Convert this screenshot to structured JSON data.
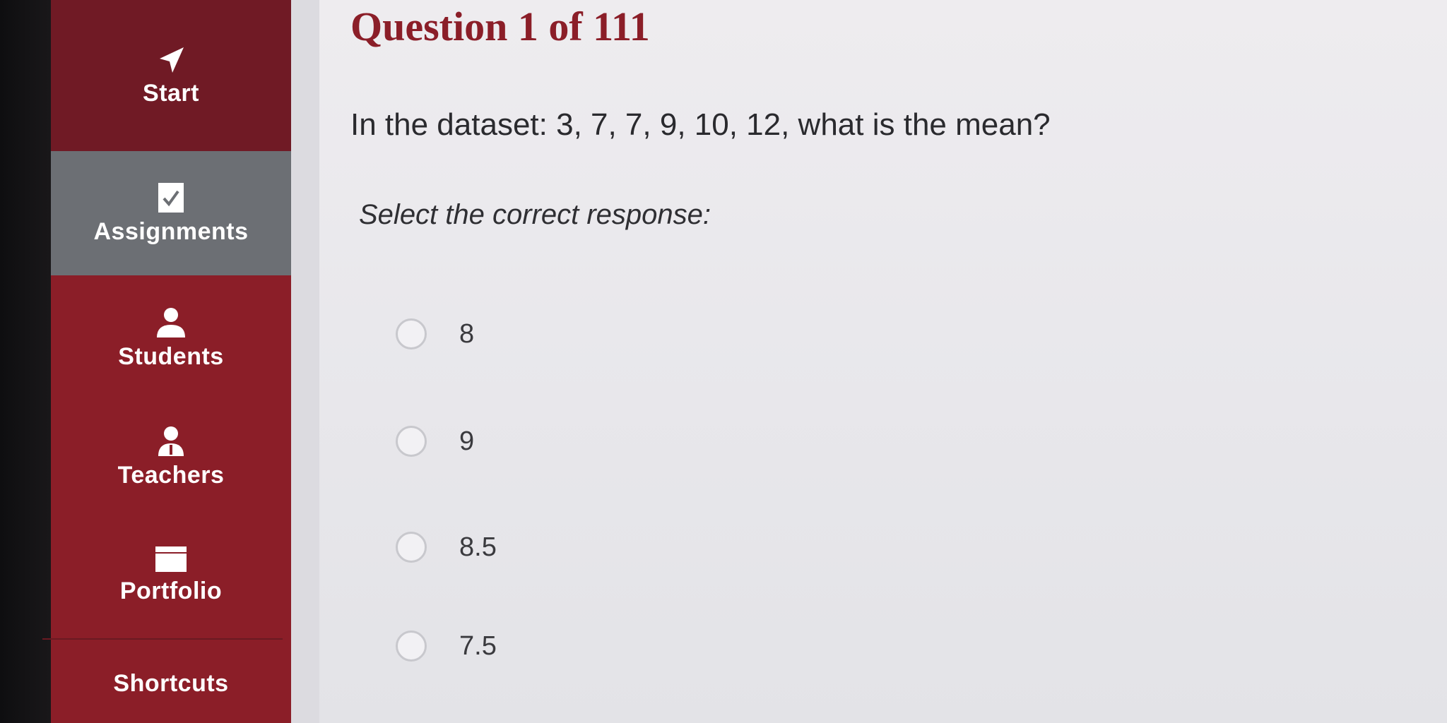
{
  "sidebar": {
    "items": [
      {
        "label": "Start",
        "icon": "arrow-icon"
      },
      {
        "label": "Assignments",
        "icon": "checkmark-document-icon",
        "active": true
      },
      {
        "label": "Students",
        "icon": "person-icon"
      },
      {
        "label": "Teachers",
        "icon": "teacher-icon"
      },
      {
        "label": "Portfolio",
        "icon": "folder-icon"
      },
      {
        "label": "Shortcuts"
      }
    ],
    "colors": {
      "background": "#8b1e28",
      "active": "#6c6f74"
    }
  },
  "question": {
    "title": "Question 1 of 111",
    "text": "In the dataset: 3, 7, 7, 9, 10, 12, what is the mean?",
    "instruction": "Select the correct response:",
    "options": [
      {
        "label": "8"
      },
      {
        "label": "9"
      },
      {
        "label": "8.5"
      },
      {
        "label": "7.5"
      }
    ]
  }
}
